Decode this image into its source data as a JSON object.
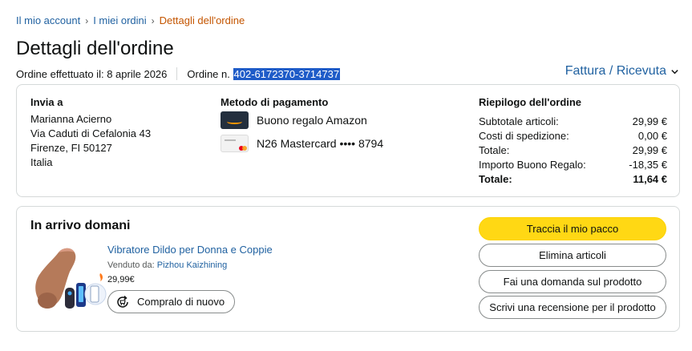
{
  "breadcrumb": {
    "items": [
      "Il mio account",
      "I miei ordini"
    ],
    "current": "Dettagli dell'ordine",
    "separator": "›"
  },
  "page": {
    "title": "Dettagli dell'ordine",
    "order_date_label": "Ordine effettuato il: 8 aprile 2026",
    "order_num_label": "Ordine n. ",
    "order_number": "402-6172370-3714737",
    "invoice_label": "Fattura / Ricevuta"
  },
  "shipping": {
    "title": "Invia a",
    "lines": [
      "Marianna Acierno",
      "Via Caduti di Cefalonia 43",
      "Firenze, FI 50127",
      "Italia"
    ]
  },
  "payment": {
    "title": "Metodo di pagamento",
    "methods": [
      {
        "label": "Buono regalo Amazon",
        "icon": "amazon-gift-card-icon"
      },
      {
        "label": "N26 Mastercard •••• 8794",
        "icon": "mastercard-icon"
      }
    ]
  },
  "summary": {
    "title": "Riepilogo dell'ordine",
    "rows": [
      {
        "label": "Subtotale articoli:",
        "value": "29,99 €"
      },
      {
        "label": "Costi di spedizione:",
        "value": "0,00 €"
      },
      {
        "label": "Totale:",
        "value": "29,99 €"
      },
      {
        "label": "Importo Buono Regalo:",
        "value": "-18,35 €"
      },
      {
        "label": "Totale:",
        "value": "11,64 €"
      }
    ]
  },
  "shipment": {
    "status": "In arrivo domani",
    "product_title": "Vibratore Dildo per Donna e Coppie",
    "sold_by_label": "Venduto da: ",
    "seller": "Pizhou Kaizhining",
    "price": "29,99€",
    "rebuy_label": "Compralo di nuovo"
  },
  "actions": {
    "track": "Traccia il mio pacco",
    "remove": "Elimina articoli",
    "question": "Fai una domanda sul prodotto",
    "review": "Scrivi una recensione per il prodotto"
  },
  "colors": {
    "link": "#2162a1",
    "breadcrumb_current": "#c45500",
    "primary_button": "#ffd814",
    "selection": "#1f5cc8"
  }
}
